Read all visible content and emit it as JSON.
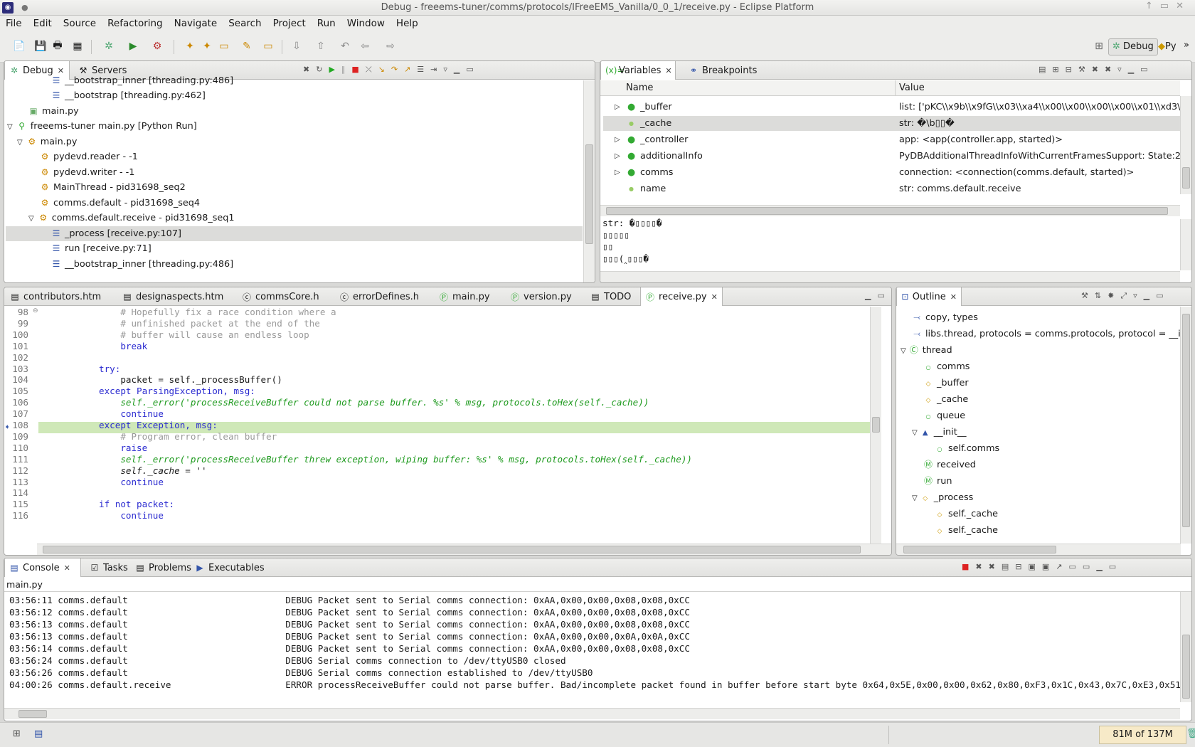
{
  "window": {
    "title": "Debug - freeems-tuner/comms/protocols/IFreeEMS_Vanilla/0_0_1/receive.py - Eclipse Platform"
  },
  "menu": [
    "File",
    "Edit",
    "Source",
    "Refactoring",
    "Navigate",
    "Search",
    "Project",
    "Run",
    "Window",
    "Help"
  ],
  "perspectives": {
    "debug": "Debug",
    "python": "Py",
    "more": "»"
  },
  "debug_view": {
    "tabs": {
      "debug": "Debug",
      "servers": "Servers"
    },
    "rows": [
      "__bootstrap_inner [threading.py:486]",
      "__bootstrap [threading.py:462]",
      "main.py",
      "freeems-tuner main.py [Python Run]",
      "main.py",
      "pydevd.reader - -1",
      "pydevd.writer - -1",
      "MainThread - pid31698_seq2",
      "comms.default - pid31698_seq4",
      "comms.default.receive - pid31698_seq1",
      "_process [receive.py:107]",
      "run [receive.py:71]",
      "__bootstrap_inner [threading.py:486]"
    ]
  },
  "variables_view": {
    "tabs": {
      "variables": "Variables",
      "breakpoints": "Breakpoints"
    },
    "columns": {
      "name": "Name",
      "value": "Value"
    },
    "rows": [
      {
        "name": "_buffer",
        "value": "list: ['pKC\\\\x9b\\\\x9fG\\\\x03\\\\xa4\\\\x00\\\\x00\\\\x00\\\\x00\\\\x01\\\\xd3\\\\x00"
      },
      {
        "name": "_cache",
        "value": "str: �\\b▯▯�"
      },
      {
        "name": "_controller",
        "value": "app: <app(controller.app, started)>"
      },
      {
        "name": "additionalInfo",
        "value": "PyDBAdditionalThreadInfoWithCurrentFramesSupport: State:2 S"
      },
      {
        "name": "comms",
        "value": "connection: <connection(comms.default, started)>"
      },
      {
        "name": "name",
        "value": "str: comms.default.receive"
      }
    ],
    "detail": [
      "str: �▯▯▯▯�",
      "▯▯▯▯▯",
      "▯▯",
      "▯▯▯(‸▯▯▯�"
    ]
  },
  "editor": {
    "tabs": [
      "contributors.htm",
      "designaspects.htm",
      "commsCore.h",
      "errorDefines.h",
      "main.py",
      "version.py",
      "TODO",
      "receive.py"
    ],
    "lines": [
      {
        "n": "98",
        "t": "                # Hopefully fix a race condition where a"
      },
      {
        "n": "99",
        "t": "                # unfinished packet at the end of the"
      },
      {
        "n": "100",
        "t": "                # buffer will cause an endless loop"
      },
      {
        "n": "101",
        "t": "                break"
      },
      {
        "n": "102",
        "t": ""
      },
      {
        "n": "103",
        "t": "            try:"
      },
      {
        "n": "104",
        "t": "                packet = self._processBuffer()"
      },
      {
        "n": "105",
        "t": "            except ParsingException, msg:"
      },
      {
        "n": "106",
        "t": "                self._error('processReceiveBuffer could not parse buffer. %s' % msg, protocols.toHex(self._cache))"
      },
      {
        "n": "107",
        "t": "                continue"
      },
      {
        "n": "108",
        "t": "            except Exception, msg:"
      },
      {
        "n": "109",
        "t": "                # Program error, clean buffer"
      },
      {
        "n": "110",
        "t": "                raise"
      },
      {
        "n": "111",
        "t": "                self._error('processReceiveBuffer threw exception, wiping buffer: %s' % msg, protocols.toHex(self._cache))"
      },
      {
        "n": "112",
        "t": "                self._cache = ''"
      },
      {
        "n": "113",
        "t": "                continue"
      },
      {
        "n": "114",
        "t": ""
      },
      {
        "n": "115",
        "t": "            if not packet:"
      },
      {
        "n": "116",
        "t": "                continue"
      }
    ]
  },
  "outline": {
    "tab": "Outline",
    "rows": [
      "copy, types",
      "libs.thread, protocols = comms.protocols, protocol = __ir",
      "thread",
      "comms",
      "_buffer",
      "_cache",
      "queue",
      "__init__",
      "self.comms",
      "received",
      "run",
      "_process",
      "self._cache",
      "self._cache"
    ]
  },
  "console": {
    "tabs": {
      "console": "Console",
      "tasks": "Tasks",
      "problems": "Problems",
      "executables": "Executables"
    },
    "title": "main.py",
    "lines": [
      {
        "time": "03:56:11",
        "src": "comms.default",
        "msg": "DEBUG Packet sent to Serial comms connection: 0xAA,0x00,0x00,0x08,0x08,0xCC"
      },
      {
        "time": "03:56:12",
        "src": "comms.default",
        "msg": "DEBUG Packet sent to Serial comms connection: 0xAA,0x00,0x00,0x08,0x08,0xCC"
      },
      {
        "time": "03:56:13",
        "src": "comms.default",
        "msg": "DEBUG Packet sent to Serial comms connection: 0xAA,0x00,0x00,0x08,0x08,0xCC"
      },
      {
        "time": "03:56:13",
        "src": "comms.default",
        "msg": "DEBUG Packet sent to Serial comms connection: 0xAA,0x00,0x00,0x0A,0x0A,0xCC"
      },
      {
        "time": "03:56:14",
        "src": "comms.default",
        "msg": "DEBUG Packet sent to Serial comms connection: 0xAA,0x00,0x00,0x08,0x08,0xCC"
      },
      {
        "time": "03:56:24",
        "src": "comms.default",
        "msg": "DEBUG Serial comms connection to /dev/ttyUSB0 closed"
      },
      {
        "time": "03:56:26",
        "src": "comms.default",
        "msg": "DEBUG Serial comms connection established to /dev/ttyUSB0"
      },
      {
        "time": "04:00:26",
        "src": "comms.default.receive",
        "msg": "ERROR processReceiveBuffer could not parse buffer. Bad/incomplete packet found in buffer before start byte 0x64,0x5E,0x00,0x00,0x62,0x80,0xF3,0x1C,0x43,0x7C,0xE3,0x51"
      }
    ]
  },
  "status": {
    "memory": "81M of 137M"
  },
  "colors": {
    "highlight_line": "#cfe8b8",
    "selected_row": "#dcdcda",
    "keyword": "#2b2bd0",
    "string": "#1e9a1e",
    "comment": "#9a9a9a"
  }
}
